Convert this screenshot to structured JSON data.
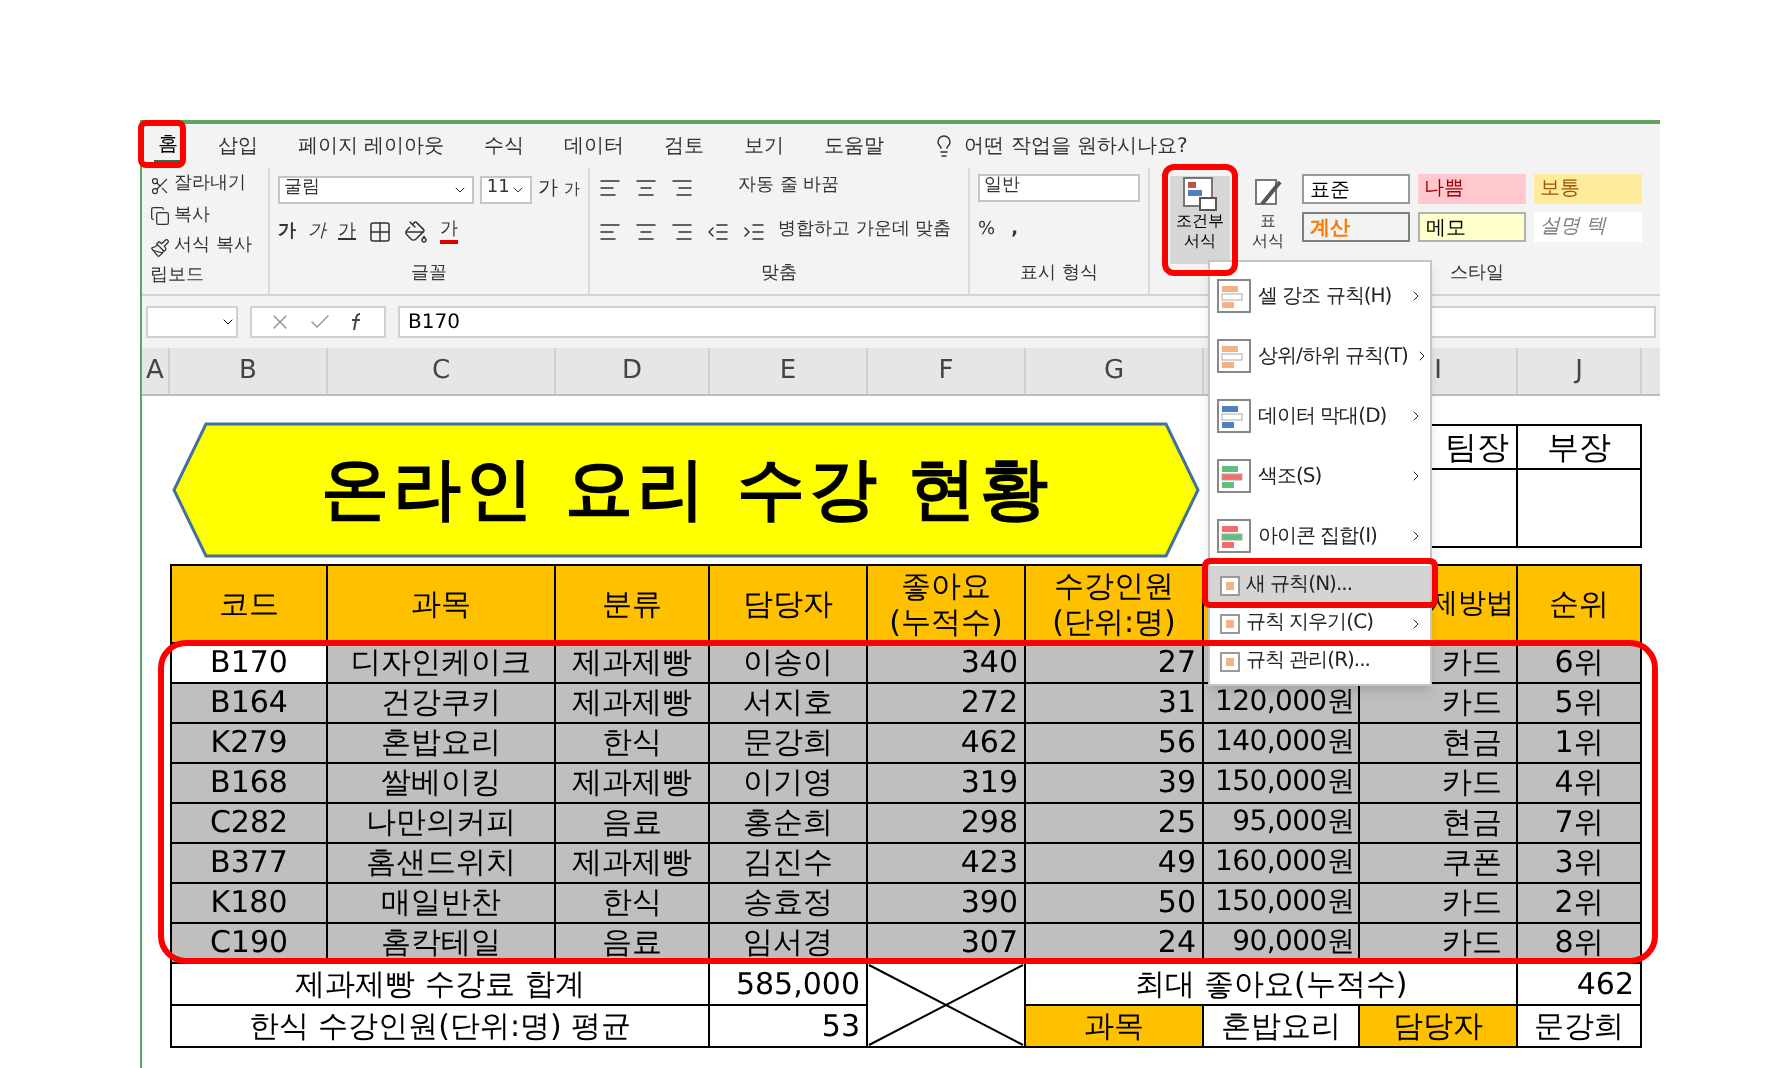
{
  "ribbon": {
    "tabs": [
      {
        "label": "홈",
        "selected": true
      },
      {
        "label": "삽입",
        "selected": false
      },
      {
        "label": "페이지 레이아웃",
        "selected": false
      },
      {
        "label": "수식",
        "selected": false
      },
      {
        "label": "데이터",
        "selected": false
      },
      {
        "label": "검토",
        "selected": false
      },
      {
        "label": "보기",
        "selected": false
      },
      {
        "label": "도움말",
        "selected": false
      }
    ],
    "search_prompt": "어떤 작업을 원하시나요?",
    "clipboard": {
      "cut": "잘라내기",
      "copy": "복사",
      "format_painter": "서식 복사",
      "group_label": "립보드"
    },
    "font": {
      "name": "굴림",
      "size": "11",
      "grow": "가",
      "shrink": "가",
      "style_buttons": [
        "가",
        "가",
        "가"
      ],
      "color_button": "가",
      "group_label": "글꼴"
    },
    "alignment": {
      "wrap_text": "자동 줄 바꿈",
      "merge_center": "병합하고 가운데 맞춤",
      "group_label": "맞춤"
    },
    "number": {
      "format": "일반",
      "percent": "%",
      "comma": ",",
      "group_label": "표시 형식"
    },
    "conditional_format": {
      "lines": [
        "조건부",
        "서식"
      ]
    },
    "table_format": {
      "lines": [
        "표",
        "서식"
      ]
    },
    "styles": {
      "items": [
        {
          "label": "표준",
          "kind": "normal"
        },
        {
          "label": "나쁨",
          "kind": "bad"
        },
        {
          "label": "보통",
          "kind": "neutral"
        },
        {
          "label": "계산",
          "kind": "calc"
        },
        {
          "label": "메모",
          "kind": "note"
        },
        {
          "label": "설명 텍",
          "kind": "explain"
        }
      ],
      "group_label": "스타일"
    }
  },
  "formula_bar": {
    "value": "B170"
  },
  "menu": {
    "items": [
      {
        "label": "셀 강조 규칙(H)",
        "kind": "large",
        "has_submenu": true,
        "selected": false
      },
      {
        "label": "상위/하위 규칙(T)",
        "kind": "large",
        "has_submenu": true,
        "selected": false
      },
      {
        "label": "데이터 막대(D)",
        "kind": "large",
        "has_submenu": true,
        "selected": false
      },
      {
        "label": "색조(S)",
        "kind": "large",
        "has_submenu": true,
        "selected": false
      },
      {
        "label": "아이콘 집합(I)",
        "kind": "large",
        "has_submenu": true,
        "selected": false
      },
      {
        "label": "새 규칙(N)...",
        "kind": "small",
        "has_submenu": false,
        "selected": true
      },
      {
        "label": "규칙 지우기(C)",
        "kind": "small",
        "has_submenu": true,
        "selected": false
      },
      {
        "label": "규칙 관리(R)...",
        "kind": "small",
        "has_submenu": false,
        "selected": false
      }
    ]
  },
  "sheet": {
    "column_headers": {
      "a": "A",
      "b": "B",
      "c": "C",
      "d": "D",
      "e": "E",
      "f": "F",
      "g": "G",
      "i": "I",
      "j": "J"
    },
    "title": "온라인 요리 수강 현황",
    "approval": [
      "팀장",
      "부장"
    ],
    "header": {
      "code": "코드",
      "course": "과목",
      "category": "분류",
      "manager": "담당자",
      "likes": [
        "좋아요",
        "(누적수)"
      ],
      "students": [
        "수강인원",
        "(단위:명)"
      ],
      "payment": "제방법",
      "rank": "순위"
    },
    "rows": [
      {
        "code": "B170",
        "course": "디자인케이크",
        "category": "제과제빵",
        "manager": "이송이",
        "likes": "340",
        "students": "27",
        "payment": "카드",
        "rank": "6위",
        "active": true
      },
      {
        "code": "B164",
        "course": "건강쿠키",
        "category": "제과제빵",
        "manager": "서지호",
        "likes": "272",
        "students": "31",
        "fee": "120,000원",
        "payment": "카드",
        "rank": "5위",
        "active": false
      },
      {
        "code": "K279",
        "course": "혼밥요리",
        "category": "한식",
        "manager": "문강희",
        "likes": "462",
        "students": "56",
        "fee": "140,000원",
        "payment": "현금",
        "rank": "1위",
        "active": false
      },
      {
        "code": "B168",
        "course": "쌀베이킹",
        "category": "제과제빵",
        "manager": "이기영",
        "likes": "319",
        "students": "39",
        "fee": "150,000원",
        "payment": "카드",
        "rank": "4위",
        "active": false
      },
      {
        "code": "C282",
        "course": "나만의커피",
        "category": "음료",
        "manager": "홍순희",
        "likes": "298",
        "students": "25",
        "fee": "95,000원",
        "payment": "현금",
        "rank": "7위",
        "active": false
      },
      {
        "code": "B377",
        "course": "홈샌드위치",
        "category": "제과제빵",
        "manager": "김진수",
        "likes": "423",
        "students": "49",
        "fee": "160,000원",
        "payment": "쿠폰",
        "rank": "3위",
        "active": false
      },
      {
        "code": "K180",
        "course": "매일반찬",
        "category": "한식",
        "manager": "송효정",
        "likes": "390",
        "students": "50",
        "fee": "150,000원",
        "payment": "카드",
        "rank": "2위",
        "active": false
      },
      {
        "code": "C190",
        "course": "홈칵테일",
        "category": "음료",
        "manager": "임서경",
        "likes": "307",
        "students": "24",
        "fee": "90,000원",
        "payment": "카드",
        "rank": "8위",
        "active": false
      }
    ],
    "summary": {
      "bakery_total_label": "제과제빵 수강료 합계",
      "bakery_total": "585,000",
      "korean_avg_label": "한식 수강인원(단위:명) 평균",
      "korean_avg": "53",
      "max_likes_label": "최대 좋아요(누적수)",
      "max_likes": "462",
      "lookup": [
        "과목",
        "혼밥요리",
        "담당자",
        "문강희"
      ]
    }
  }
}
